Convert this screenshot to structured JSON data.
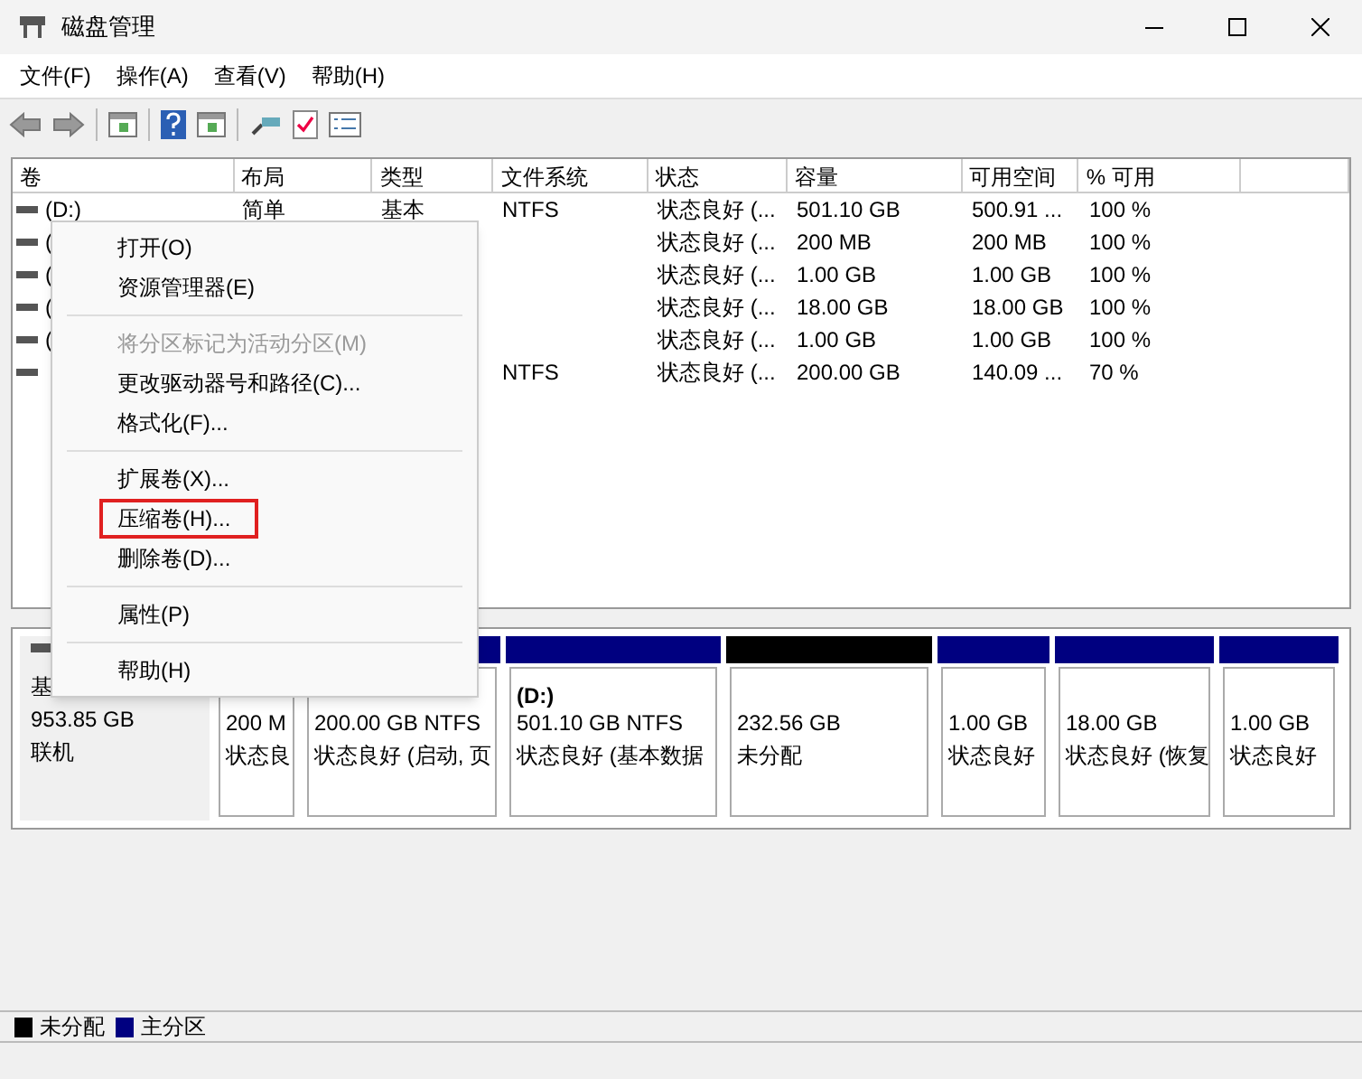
{
  "window": {
    "title": "磁盘管理"
  },
  "menu_bar": [
    "文件(F)",
    "操作(A)",
    "查看(V)",
    "帮助(H)"
  ],
  "table": {
    "columns": [
      "卷",
      "布局",
      "类型",
      "文件系统",
      "状态",
      "容量",
      "可用空间",
      "% 可用"
    ],
    "rows": [
      {
        "volume": "(D:)",
        "layout": "简单",
        "type": "基本",
        "fs": "NTFS",
        "status": "状态良好 (...",
        "capacity": "501.10 GB",
        "free": "500.91 ...",
        "pct": "100 %"
      },
      {
        "volume": "(",
        "status": "状态良好 (...",
        "capacity": "200 MB",
        "free": "200 MB",
        "pct": "100 %"
      },
      {
        "volume": "(",
        "status": "状态良好 (...",
        "capacity": "1.00 GB",
        "free": "1.00 GB",
        "pct": "100 %"
      },
      {
        "volume": "(",
        "status": "状态良好 (...",
        "capacity": "18.00 GB",
        "free": "18.00 GB",
        "pct": "100 %"
      },
      {
        "volume": "(",
        "status": "状态良好 (...",
        "capacity": "1.00 GB",
        "free": "1.00 GB",
        "pct": "100 %"
      },
      {
        "fs": "NTFS",
        "status": "状态良好 (...",
        "capacity": "200.00 GB",
        "free": "140.09 ...",
        "pct": "70 %"
      }
    ]
  },
  "context_menu": [
    {
      "kind": "item",
      "label": "打开(O)",
      "disabled": false,
      "highlighted": false
    },
    {
      "kind": "item",
      "label": "资源管理器(E)",
      "disabled": false,
      "highlighted": false
    },
    {
      "kind": "separator"
    },
    {
      "kind": "item",
      "label": "将分区标记为活动分区(M)",
      "disabled": true,
      "highlighted": false
    },
    {
      "kind": "item",
      "label": "更改驱动器号和路径(C)...",
      "disabled": false,
      "highlighted": false
    },
    {
      "kind": "item",
      "label": "格式化(F)...",
      "disabled": false,
      "highlighted": false
    },
    {
      "kind": "separator"
    },
    {
      "kind": "item",
      "label": "扩展卷(X)...",
      "disabled": false,
      "highlighted": false
    },
    {
      "kind": "item",
      "label": "压缩卷(H)...",
      "disabled": false,
      "highlighted": true
    },
    {
      "kind": "item",
      "label": "删除卷(D)...",
      "disabled": false,
      "highlighted": false
    },
    {
      "kind": "separator"
    },
    {
      "kind": "item",
      "label": "属性(P)",
      "disabled": false,
      "highlighted": false
    },
    {
      "kind": "separator"
    },
    {
      "kind": "item",
      "label": "帮助(H)",
      "disabled": false,
      "highlighted": false
    }
  ],
  "disk": {
    "label": "基",
    "size": "953.85 GB",
    "state": "联机",
    "partitions": [
      {
        "kind": "primary",
        "line_1": "200 M",
        "line_2": "状态良"
      },
      {
        "kind": "primary",
        "line_1": "200.00 GB NTFS",
        "line_2": "状态良好 (启动, 页"
      },
      {
        "kind": "primary",
        "title": "(D:)",
        "line_1": "501.10 GB NTFS",
        "line_2": "状态良好 (基本数据"
      },
      {
        "kind": "unallocated",
        "line_1": "232.56 GB",
        "line_2": "未分配"
      },
      {
        "kind": "primary",
        "line_1": "1.00 GB",
        "line_2": "状态良好"
      },
      {
        "kind": "primary",
        "line_1": "18.00 GB",
        "line_2": "状态良好 (恢复"
      },
      {
        "kind": "primary",
        "line_1": "1.00 GB",
        "line_2": "状态良好"
      }
    ]
  },
  "legend": [
    {
      "label": "未分配",
      "color": "#000000"
    },
    {
      "label": "主分区",
      "color": "#000080"
    }
  ]
}
